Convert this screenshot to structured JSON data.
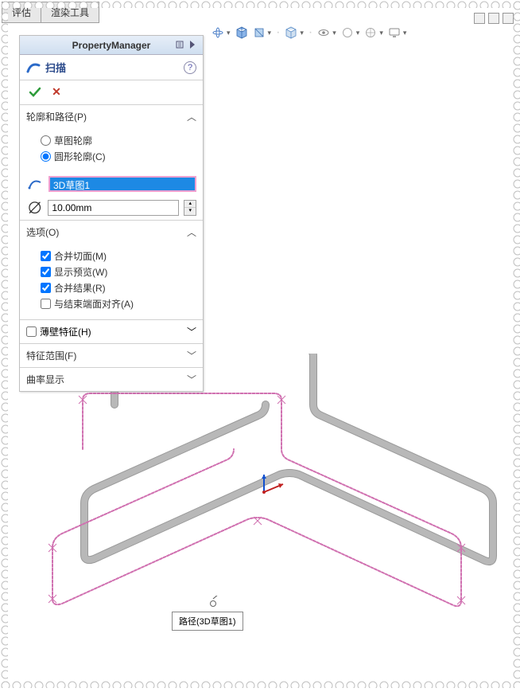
{
  "tabs": {
    "evaluate": "评估",
    "render_tools": "渲染工具"
  },
  "pm": {
    "title": "PropertyManager",
    "feature_name": "扫描",
    "help": "?",
    "sections": {
      "profile_path": {
        "title": "轮廓和路径(P)",
        "radio_sketch": "草图轮廓",
        "radio_circle": "圆形轮廓(C)",
        "selection": "3D草图1",
        "diameter": "10.00mm"
      },
      "options": {
        "title": "选项(O)",
        "merge_tangent": "合并切面(M)",
        "show_preview": "显示预览(W)",
        "merge_result": "合并结果(R)",
        "align_end": "与结束端面对齐(A)"
      },
      "thin": {
        "title": "薄壁特征(H)"
      },
      "scope": {
        "title": "特征范围(F)"
      },
      "curvature": {
        "title": "曲率显示"
      }
    }
  },
  "callout": {
    "label": "路径(3D草图1)"
  }
}
